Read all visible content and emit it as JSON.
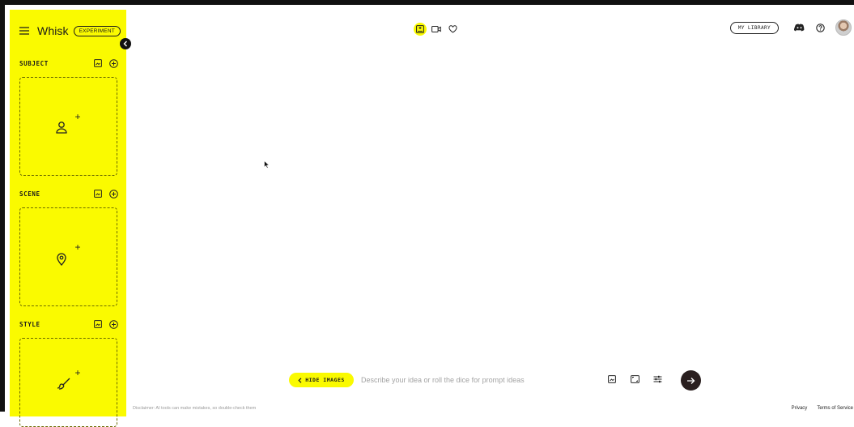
{
  "app": {
    "brand": "Whisk",
    "badge": "EXPERIMENT"
  },
  "sidebar": {
    "sections": [
      {
        "title": "SUBJECT",
        "drop_icon": "person-add-icon"
      },
      {
        "title": "SCENE",
        "drop_icon": "location-pin-icon"
      },
      {
        "title": "STYLE",
        "drop_icon": "brush-icon"
      }
    ],
    "section_icons": [
      "image-upload-icon",
      "add-circle-icon"
    ],
    "collapse_icon": "chevron-left-icon"
  },
  "view_toggle": {
    "items": [
      "image-icon",
      "video-icon",
      "heart-icon"
    ],
    "active": "image-icon"
  },
  "header_right": {
    "library_label": "MY LIBRARY",
    "icons": [
      "discord-icon",
      "help-icon"
    ]
  },
  "prompt_bar": {
    "hide_label": "HIDE IMAGES",
    "placeholder": "Describe your idea or roll the dice for prompt ideas",
    "icons": [
      "image-upload-icon",
      "aspect-ratio-icon",
      "settings-sliders-icon"
    ]
  },
  "footer": {
    "disclaimer": "Disclaimer: AI tools can make mistakes, so double-check them",
    "privacy": "Privacy",
    "terms": "Terms of Service"
  },
  "colors": {
    "accent": "#fafa00",
    "dark": "#2a1f1f"
  }
}
